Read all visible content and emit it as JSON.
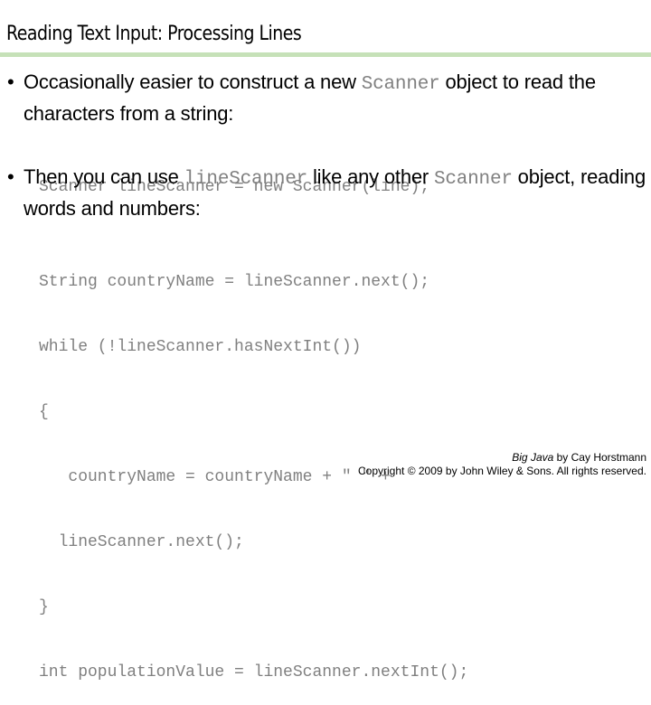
{
  "slide": {
    "title": "Reading Text Input: Processing Lines",
    "accent_color": "#c6e1b8",
    "code_color": "#808080"
  },
  "bullets": [
    {
      "glyph": "•",
      "parts": [
        {
          "type": "text",
          "value": "Occasionally easier to construct a new "
        },
        {
          "type": "code",
          "value": "Scanner"
        },
        {
          "type": "text",
          "value": " object to read the characters from a string:"
        }
      ]
    },
    {
      "glyph": "•",
      "parts": [
        {
          "type": "text",
          "value": "Then you can use "
        },
        {
          "type": "code",
          "value": "lineScanner"
        },
        {
          "type": "text",
          "value": " like any other "
        },
        {
          "type": "code",
          "value": "Scanner"
        },
        {
          "type": "text",
          "value": " object, reading words and numbers:"
        }
      ]
    }
  ],
  "code_blocks": [
    {
      "lines": [
        "Scanner lineScanner = new Scanner(line);"
      ]
    },
    {
      "lines": [
        "String countryName = lineScanner.next();",
        "while (!lineScanner.hasNextInt())",
        "{",
        "   countryName = countryName + \" \" +",
        "  lineScanner.next();",
        "}",
        "int populationValue = lineScanner.nextInt();"
      ]
    }
  ],
  "footer": {
    "book_title": "Big Java",
    "byline": " by Cay Horstmann",
    "copyright": "Copyright © 2009 by John Wiley & Sons.  All rights reserved."
  }
}
